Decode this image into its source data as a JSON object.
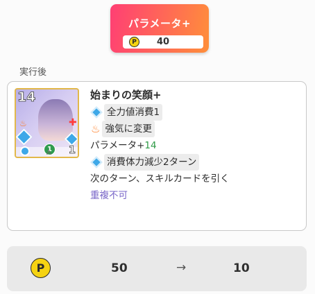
{
  "param_card": {
    "title": "パラメータ+",
    "cost_icon": "P",
    "cost": "40"
  },
  "section_label": "実行後",
  "card": {
    "thumb": {
      "level": "14",
      "badge_one": "1",
      "corner_number": "1",
      "bottom_letter": "A"
    },
    "name": "始まりの笑顔+",
    "lines": {
      "l1": "全力値消費1",
      "l2": "強気に変更",
      "l3_prefix": "パラメータ+",
      "l3_value": "14",
      "l4": "消費体力減少2ターン",
      "l5": "次のターン、スキルカードを引く",
      "l6": "重複不可"
    }
  },
  "p_change": {
    "icon": "P",
    "before": "50",
    "arrow": "→",
    "after": "10"
  },
  "colors": {
    "badge_gradient_start": "#ff3f74",
    "badge_gradient_end": "#ff8f3a",
    "highlight_green": "#2e9a46",
    "highlight_purple": "#7966c8",
    "coin_yellow": "#f5d312"
  }
}
